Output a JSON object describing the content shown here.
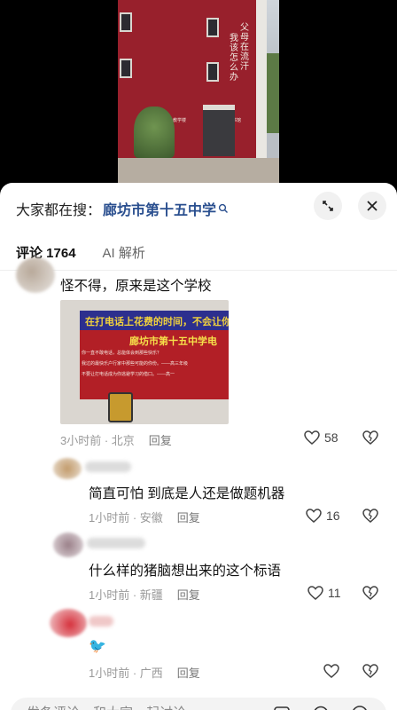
{
  "video": {
    "slogan_right": "父母在流汗",
    "slogan_left": "我该怎么办",
    "plaque_left": "教学楼",
    "plaque_right": "图书馆"
  },
  "search": {
    "prefix": "大家都在搜：",
    "term": "廊坊市第十五中学"
  },
  "tabs": [
    {
      "label": "评论 1764"
    },
    {
      "label": "AI 解析"
    }
  ],
  "comments": [
    {
      "text": "怪不得，原来是这个学校",
      "image": {
        "banner_top": "在打电话上花费的时间，不会让你",
        "banner_title": "廊坊市第十五中学电",
        "banner_line1": "你一直不敢电话，总能体会到那些快乐？",
        "banner_line2": "我过的最快乐户行家中那些可能的你份。——高三年级",
        "banner_line3": "不要让打电话成为你逃避学习的借口。——高一"
      },
      "time": "3小时前 · 北京",
      "reply": "回复",
      "likes": "58"
    },
    {
      "text": "简直可怕 到底是人还是做题机器",
      "time": "1小时前 · 安徽",
      "reply": "回复",
      "likes": "16"
    },
    {
      "text": "什么样的猪脑想出来的这个标语",
      "time": "1小时前 · 新疆",
      "reply": "回复",
      "likes": "11"
    },
    {
      "text": "",
      "time": "1小时前 · 广西",
      "reply": "回复",
      "likes": ""
    }
  ],
  "input": {
    "placeholder": "发条评论，和大家一起讨论"
  },
  "colors": {
    "link": "#2a4f8f",
    "building_red": "#98202c"
  }
}
